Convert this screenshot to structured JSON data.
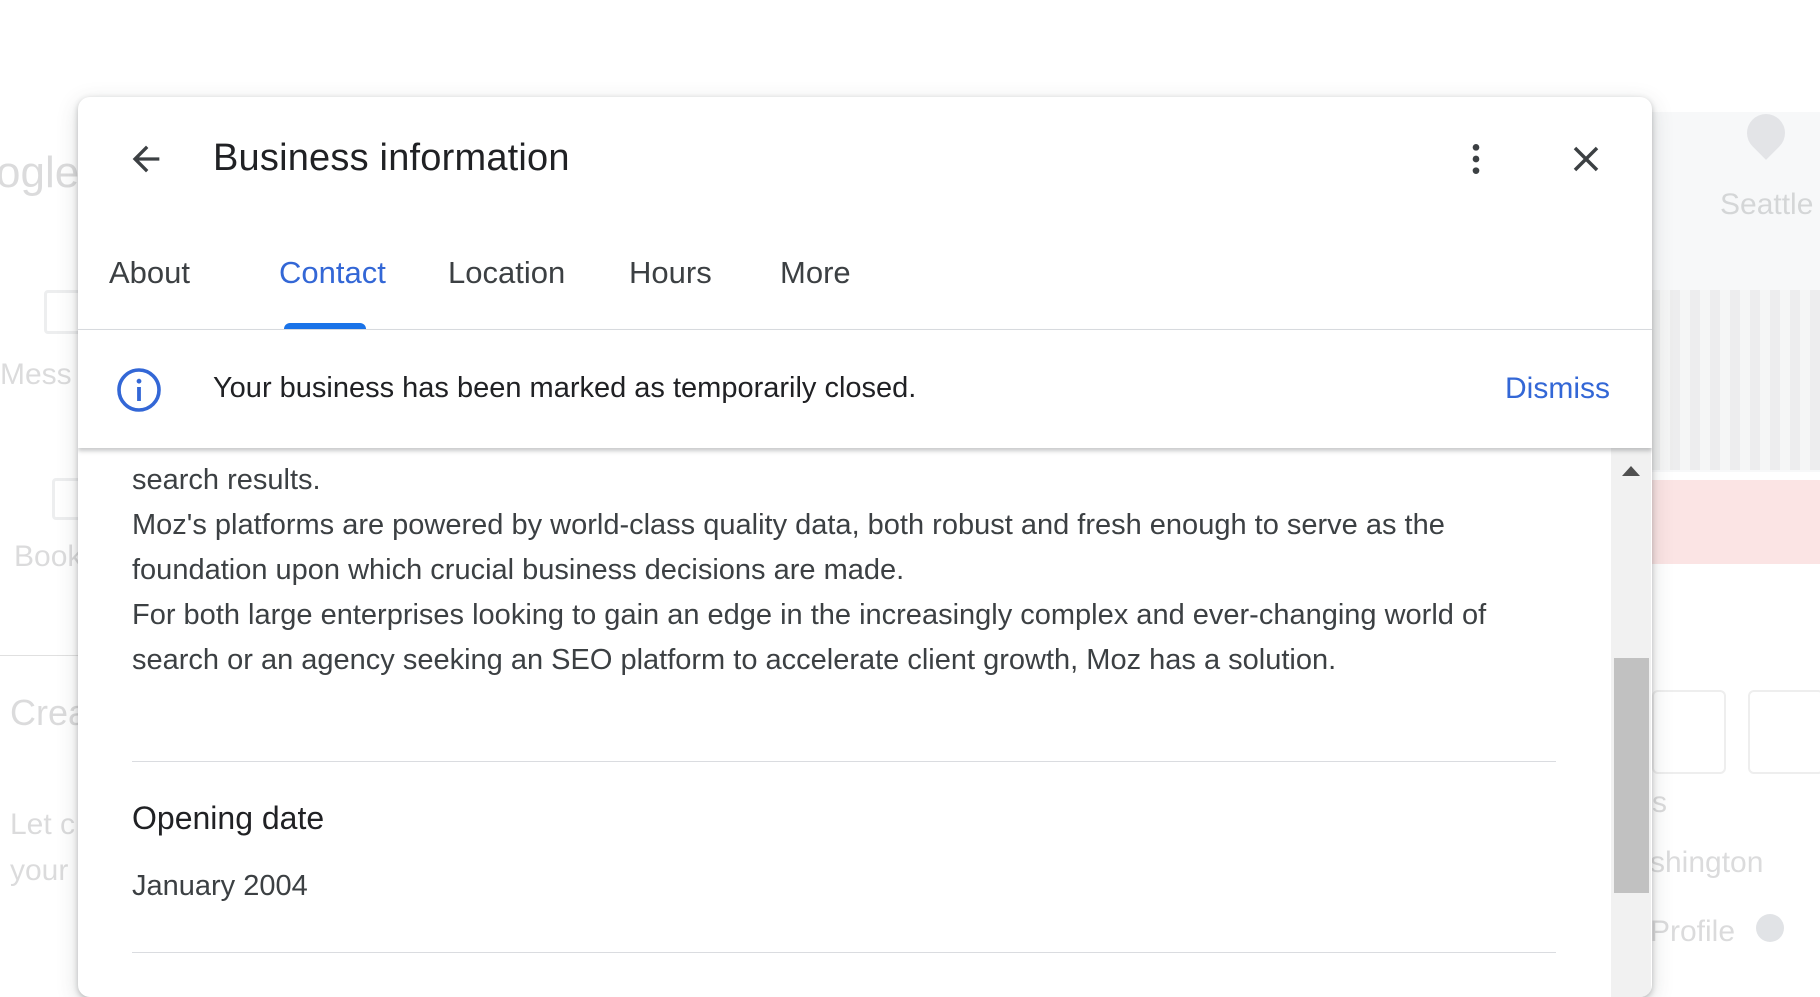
{
  "background": {
    "logo_fragment": "ogle",
    "messages_fragment": "Mess",
    "bookings_fragment": "Book",
    "create_fragment": "Crea",
    "let_fragment": "Let c",
    "your_fragment": "your",
    "city_fragment": "Seattle",
    "s_fragment": "s",
    "washington_fragment": "shington",
    "profile_fragment": "Profile"
  },
  "dialog": {
    "title": "Business information",
    "back_icon": "arrow-left-icon",
    "more_icon": "more-vert-icon",
    "close_icon": "close-icon",
    "tabs": [
      {
        "label": "About",
        "active": false
      },
      {
        "label": "Contact",
        "active": true
      },
      {
        "label": "Location",
        "active": false
      },
      {
        "label": "Hours",
        "active": false
      },
      {
        "label": "More",
        "active": false
      }
    ],
    "banner": {
      "icon": "info-icon",
      "text": "Your business has been marked as temporarily closed.",
      "dismiss_label": "Dismiss"
    },
    "description": {
      "line1": "search results.",
      "line2": "Moz's platforms are powered by world-class quality data, both robust and fresh enough to serve as the foundation upon which crucial business decisions are made.",
      "line3": "For both large enterprises looking to gain an edge in the increasingly complex and ever-changing world of search or an agency seeking an SEO platform to accelerate client growth, Moz has a solution."
    },
    "opening_date": {
      "label": "Opening date",
      "value": "January 2004"
    }
  },
  "colors": {
    "accent": "#1a73e8",
    "link": "#3367d6",
    "text_primary": "#202124",
    "text_secondary": "#3c4043"
  }
}
